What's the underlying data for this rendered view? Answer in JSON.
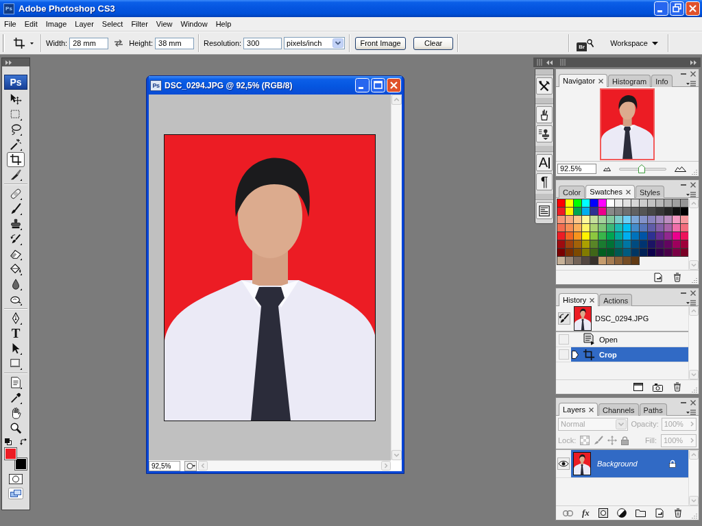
{
  "window": {
    "app_icon": "Ps",
    "title": "Adobe Photoshop CS3"
  },
  "menu": [
    "File",
    "Edit",
    "Image",
    "Layer",
    "Select",
    "Filter",
    "View",
    "Window",
    "Help"
  ],
  "options_bar": {
    "width": {
      "label": "Width:",
      "value": "28 mm"
    },
    "height": {
      "label": "Height:",
      "value": "38 mm"
    },
    "resolution": {
      "label": "Resolution:",
      "value": "300",
      "unit": "pixels/inch"
    },
    "buttons": [
      "Front Image",
      "Clear"
    ],
    "bridge_label": "Br",
    "workspace": "Workspace"
  },
  "toolbox": {
    "logo": "Ps",
    "groups": [
      [
        {
          "kind": "move",
          "selected": false
        },
        {
          "kind": "marquee",
          "selected": false
        },
        {
          "kind": "lasso",
          "selected": false
        },
        {
          "kind": "wand",
          "selected": false
        },
        {
          "kind": "crop",
          "selected": true
        },
        {
          "kind": "slice",
          "selected": false
        }
      ],
      [
        {
          "kind": "healing",
          "selected": false
        },
        {
          "kind": "brush",
          "selected": false
        },
        {
          "kind": "stamp",
          "selected": false
        },
        {
          "kind": "history-brush",
          "selected": false
        },
        {
          "kind": "eraser",
          "selected": false
        },
        {
          "kind": "bucket",
          "selected": false
        },
        {
          "kind": "blur",
          "selected": false
        },
        {
          "kind": "dodge",
          "selected": false
        }
      ],
      [
        {
          "kind": "pen",
          "selected": false
        },
        {
          "kind": "type",
          "label": "T",
          "selected": false
        },
        {
          "kind": "path-select",
          "selected": false
        },
        {
          "kind": "shape",
          "selected": false
        }
      ],
      [
        {
          "kind": "notes",
          "selected": false
        },
        {
          "kind": "eyedropper",
          "selected": false
        },
        {
          "kind": "hand",
          "selected": false
        },
        {
          "kind": "zoom",
          "selected": false
        }
      ]
    ],
    "colors": [
      {
        "kind": "foreground",
        "color": "#ec1c24"
      },
      {
        "kind": "background",
        "color": "#000000"
      }
    ]
  },
  "document": {
    "icon_label": "Ps",
    "title": "DSC_0294.JPG @ 92,5% (RGB/8)",
    "zoom": "92,5%"
  },
  "dock": {
    "icon_groups": [
      [
        {
          "kind": "tool-presets"
        }
      ],
      [
        {
          "kind": "brushes"
        },
        {
          "kind": "clone-source"
        }
      ],
      [
        {
          "kind": "character",
          "label": "A"
        },
        {
          "kind": "paragraph",
          "label": "¶"
        }
      ],
      [
        {
          "kind": "layer-comps"
        }
      ]
    ]
  },
  "navigator_panel": {
    "tabs": [
      {
        "label": "Navigator",
        "selected": true
      },
      {
        "label": "Histogram",
        "selected": false
      },
      {
        "label": "Info",
        "selected": false
      }
    ],
    "zoom": "92.5%",
    "zoom_slider": {
      "level": 0.48
    }
  },
  "color_panel": {
    "tabs": [
      {
        "label": "Color",
        "selected": false
      },
      {
        "label": "Swatches",
        "selected": true
      },
      {
        "label": "Styles",
        "selected": false
      }
    ],
    "swatches": [
      {
        "color": "#ff0000"
      },
      {
        "color": "#ffff00"
      },
      {
        "color": "#00ff00"
      },
      {
        "color": "#00ffff"
      },
      {
        "color": "#0000ff"
      },
      {
        "color": "#ff00ff"
      },
      {
        "color": "#ffffff"
      },
      {
        "color": "#ebebeb"
      },
      {
        "color": "#e1e1e1"
      },
      {
        "color": "#d7d7d7"
      },
      {
        "color": "#cccccc"
      },
      {
        "color": "#c2c2c2"
      },
      {
        "color": "#b7b7b7"
      },
      {
        "color": "#acacac"
      },
      {
        "color": "#a0a0a0"
      },
      {
        "color": "#959595"
      },
      {
        "color": "#ed1c24"
      },
      {
        "color": "#fff200"
      },
      {
        "color": "#00a651"
      },
      {
        "color": "#00aeef"
      },
      {
        "color": "#2e3192"
      },
      {
        "color": "#ec008c"
      },
      {
        "color": "#898989"
      },
      {
        "color": "#7d7d7d"
      },
      {
        "color": "#707070"
      },
      {
        "color": "#626262"
      },
      {
        "color": "#555555"
      },
      {
        "color": "#464646"
      },
      {
        "color": "#363636"
      },
      {
        "color": "#262626"
      },
      {
        "color": "#111111"
      },
      {
        "color": "#000000"
      },
      {
        "color": "#f7977a"
      },
      {
        "color": "#f9ad81"
      },
      {
        "color": "#fdc68a"
      },
      {
        "color": "#fff79a"
      },
      {
        "color": "#c4df9b"
      },
      {
        "color": "#a3d39c"
      },
      {
        "color": "#82ca9d"
      },
      {
        "color": "#7bcdc8"
      },
      {
        "color": "#6ecff6"
      },
      {
        "color": "#7ea7d8"
      },
      {
        "color": "#8493ca"
      },
      {
        "color": "#8882be"
      },
      {
        "color": "#a187be"
      },
      {
        "color": "#bc8dbf"
      },
      {
        "color": "#f49ac2"
      },
      {
        "color": "#f6989d"
      },
      {
        "color": "#f26c4f"
      },
      {
        "color": "#f68e55"
      },
      {
        "color": "#fbaf5c"
      },
      {
        "color": "#fff467"
      },
      {
        "color": "#acd372"
      },
      {
        "color": "#7cc576"
      },
      {
        "color": "#3bb878"
      },
      {
        "color": "#1abbb4"
      },
      {
        "color": "#00bff3"
      },
      {
        "color": "#438ccb"
      },
      {
        "color": "#5574b9"
      },
      {
        "color": "#605ca8"
      },
      {
        "color": "#855fa8"
      },
      {
        "color": "#a763a8"
      },
      {
        "color": "#f06ea9"
      },
      {
        "color": "#f26d7d"
      },
      {
        "color": "#ed1c25"
      },
      {
        "color": "#f26522"
      },
      {
        "color": "#f7941d"
      },
      {
        "color": "#fff201"
      },
      {
        "color": "#8dc73f"
      },
      {
        "color": "#39b54a"
      },
      {
        "color": "#00a652"
      },
      {
        "color": "#00a99d"
      },
      {
        "color": "#00aef0"
      },
      {
        "color": "#0072bc"
      },
      {
        "color": "#0054a6"
      },
      {
        "color": "#2e3193"
      },
      {
        "color": "#662d91"
      },
      {
        "color": "#92278f"
      },
      {
        "color": "#ec008d"
      },
      {
        "color": "#ed145b"
      },
      {
        "color": "#9e0b0f"
      },
      {
        "color": "#a0410d"
      },
      {
        "color": "#a36209"
      },
      {
        "color": "#aba000"
      },
      {
        "color": "#598527"
      },
      {
        "color": "#1a7b30"
      },
      {
        "color": "#007236"
      },
      {
        "color": "#00746b"
      },
      {
        "color": "#0076a3"
      },
      {
        "color": "#004b80"
      },
      {
        "color": "#003471"
      },
      {
        "color": "#1b1464"
      },
      {
        "color": "#440e62"
      },
      {
        "color": "#630460"
      },
      {
        "color": "#9e005d"
      },
      {
        "color": "#9e0039"
      },
      {
        "color": "#790000"
      },
      {
        "color": "#7b2e00"
      },
      {
        "color": "#7d4900"
      },
      {
        "color": "#827b00"
      },
      {
        "color": "#406618"
      },
      {
        "color": "#005e20"
      },
      {
        "color": "#005826"
      },
      {
        "color": "#005952"
      },
      {
        "color": "#005b7f"
      },
      {
        "color": "#003663"
      },
      {
        "color": "#002157"
      },
      {
        "color": "#0d004c"
      },
      {
        "color": "#32004b"
      },
      {
        "color": "#4b0049"
      },
      {
        "color": "#7b0046"
      },
      {
        "color": "#7a0026"
      },
      {
        "color": "#c7b299"
      },
      {
        "color": "#998675"
      },
      {
        "color": "#736357"
      },
      {
        "color": "#534741"
      },
      {
        "color": "#37302a"
      },
      {
        "color": "#c69c6d"
      },
      {
        "color": "#a67c52"
      },
      {
        "color": "#8c6239"
      },
      {
        "color": "#754c24"
      },
      {
        "color": "#603913"
      }
    ]
  },
  "history_panel": {
    "tabs": [
      {
        "label": "History",
        "selected": true
      },
      {
        "label": "Actions",
        "selected": false
      }
    ],
    "snapshot": {
      "label": "DSC_0294.JPG"
    },
    "states": [
      {
        "kind": "open",
        "label": "Open",
        "selected": false
      },
      {
        "kind": "crop",
        "label": "Crop",
        "selected": true
      }
    ]
  },
  "layers_panel": {
    "tabs": [
      {
        "label": "Layers",
        "selected": true
      },
      {
        "label": "Channels",
        "selected": false
      },
      {
        "label": "Paths",
        "selected": false
      }
    ],
    "blend_mode": {
      "value": "Normal",
      "disabled": true
    },
    "opacity": {
      "label": "Opacity:",
      "value": "100%",
      "disabled": true
    },
    "lock": {
      "label": "Lock:",
      "disabled": true
    },
    "fill": {
      "label": "Fill:",
      "value": "100%",
      "disabled": true
    },
    "fx_label": "fx",
    "layers": [
      {
        "name": "Background",
        "selected": true,
        "visible": true,
        "locked": true
      }
    ]
  }
}
